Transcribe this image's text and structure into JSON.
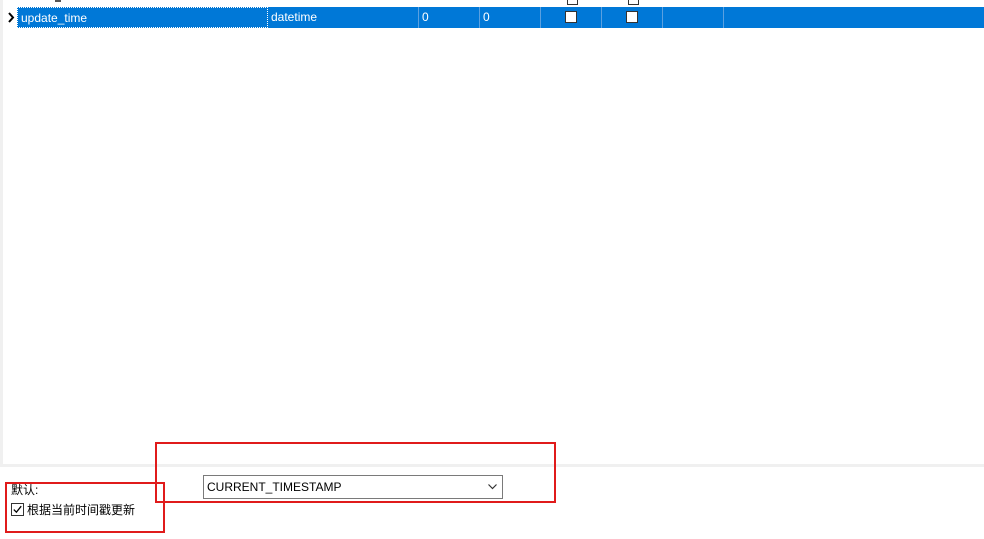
{
  "grid": {
    "selected_row": {
      "name": "update_time",
      "type": "datetime",
      "length": "0",
      "decimals": "0",
      "not_null": false,
      "virtual": false
    }
  },
  "properties": {
    "default_label": "默认:",
    "default_value": "CURRENT_TIMESTAMP",
    "on_update_label": "根据当前时间戳更新",
    "on_update_checked": true
  },
  "colors": {
    "selection": "#0078d7",
    "annotation": "#e01b1b"
  },
  "icons": [
    "row-pointer-icon",
    "chevron-down-icon",
    "checkmark-icon"
  ]
}
